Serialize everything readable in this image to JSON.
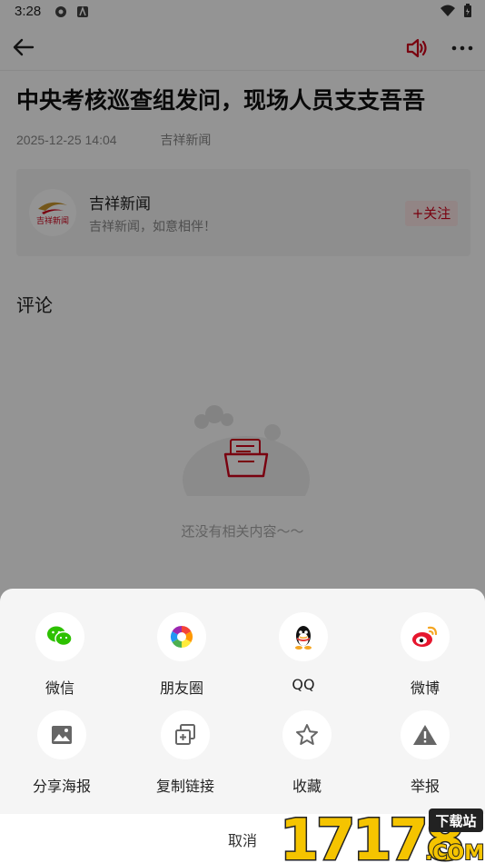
{
  "status_bar": {
    "time": "3:28"
  },
  "article": {
    "title": "中央考核巡查组发问，现场人员支支吾吾",
    "date": "2025-12-25 14:04",
    "source": "吉祥新闻"
  },
  "source_card": {
    "name": "吉祥新闻",
    "slogan": "吉祥新闻，如意相伴！",
    "logo_text": "吉祥新闻",
    "follow_label": "+关注"
  },
  "comments": {
    "title": "评论",
    "empty_text": "还没有相关内容～～"
  },
  "share_sheet": {
    "items": [
      {
        "label": "微信",
        "icon": "wechat-icon"
      },
      {
        "label": "朋友圈",
        "icon": "moments-icon"
      },
      {
        "label": "QQ",
        "icon": "qq-icon"
      },
      {
        "label": "微博",
        "icon": "weibo-icon"
      },
      {
        "label": "分享海报",
        "icon": "poster-icon"
      },
      {
        "label": "复制链接",
        "icon": "copy-link-icon"
      },
      {
        "label": "收藏",
        "icon": "favorite-star-icon"
      },
      {
        "label": "举报",
        "icon": "report-warning-icon"
      }
    ],
    "cancel_label": "取消"
  },
  "watermark": {
    "brand": "17178",
    "tag": "下载站",
    "suffix": ".COM"
  },
  "colors": {
    "accent": "#d0021b",
    "wechat": "#2dc100",
    "weibo": "#e6162d"
  }
}
